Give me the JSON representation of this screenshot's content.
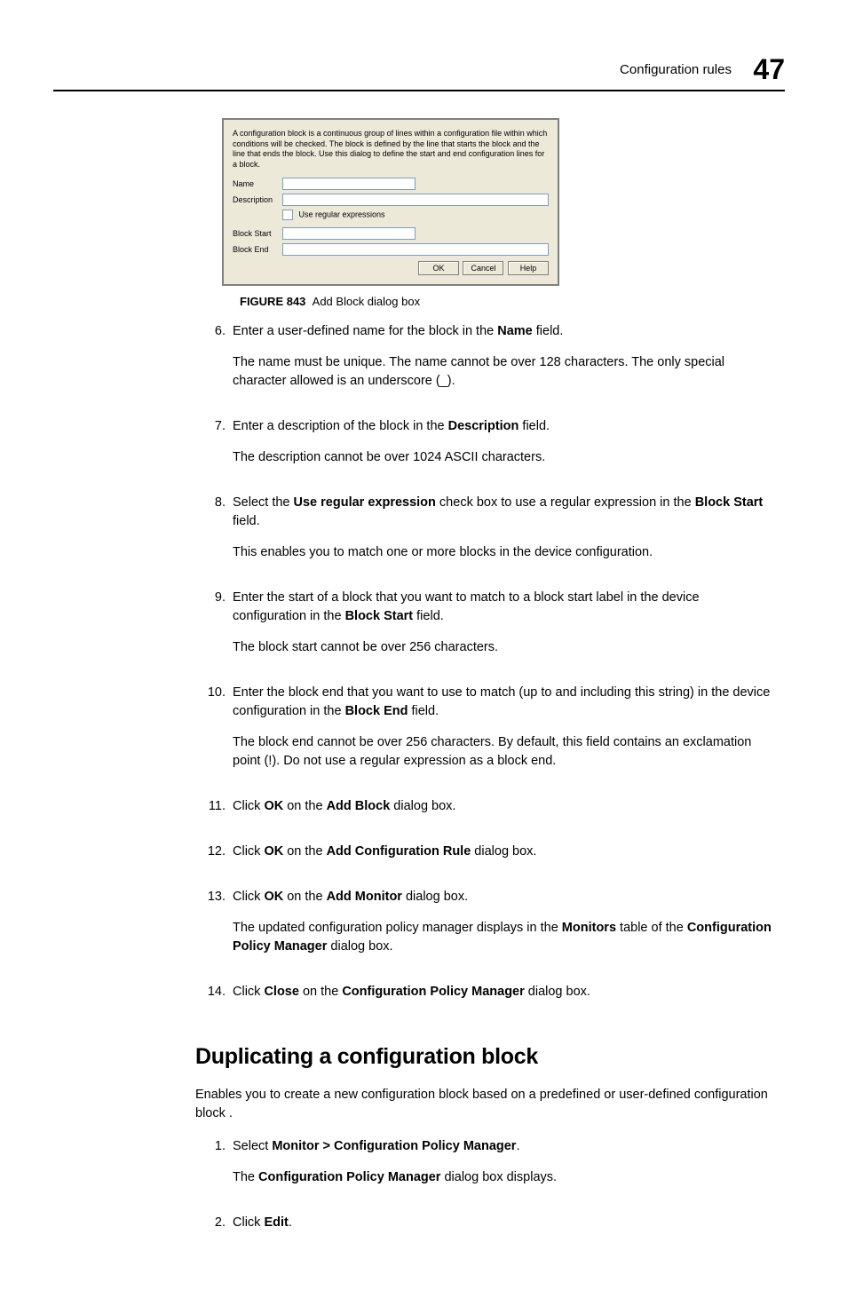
{
  "header": {
    "title": "Configuration rules",
    "pageNumber": "47"
  },
  "dialog": {
    "intro": "A configuration block is a continuous group of lines within a configuration file within which conditions will be checked. The block is defined by the line that starts the block and the line that ends the block. Use this dialog to define the start and end configuration lines for a block.",
    "labels": {
      "name": "Name",
      "description": "Description",
      "regex": "Use regular expressions",
      "blockStart": "Block Start",
      "blockEnd": "Block End"
    },
    "buttons": {
      "ok": "OK",
      "cancel": "Cancel",
      "help": "Help"
    }
  },
  "figure": {
    "label": "FIGURE 843",
    "caption": "Add Block dialog box"
  },
  "steps": {
    "s6": {
      "num": "6.",
      "t1a": "Enter a user-defined name for the block in the ",
      "b1": "Name",
      "t1b": " field.",
      "t2": "The name must be unique. The name cannot be over 128 characters. The only special character allowed is an underscore (_)."
    },
    "s7": {
      "num": "7.",
      "t1a": "Enter a description of the block in the ",
      "b1": "Description",
      "t1b": " field.",
      "t2": "The description cannot be over 1024 ASCII characters."
    },
    "s8": {
      "num": "8.",
      "t1a": "Select the ",
      "b1": "Use regular expression",
      "t1b": " check box to use a regular expression in the ",
      "b2": "Block Start",
      "t1c": " field.",
      "t2": "This enables you to match one or more blocks in the device configuration."
    },
    "s9": {
      "num": "9.",
      "t1a": "Enter the start of a block that you want to match to a block start label in the device configuration in the ",
      "b1": "Block Start",
      "t1b": " field.",
      "t2": "The block start cannot be over 256 characters."
    },
    "s10": {
      "num": "10.",
      "t1a": "Enter the block end that you want to use to match (up to and including this string) in the device configuration in the ",
      "b1": "Block End",
      "t1b": " field.",
      "t2": "The block end cannot be over 256 characters. By default, this field contains an exclamation point (!). Do not use a regular expression as a block end."
    },
    "s11": {
      "num": "11.",
      "t1a": "Click ",
      "b1": "OK",
      "t1b": " on the ",
      "b2": "Add Block",
      "t1c": " dialog box."
    },
    "s12": {
      "num": "12.",
      "t1a": "Click ",
      "b1": "OK",
      "t1b": " on the ",
      "b2": "Add Configuration Rule",
      "t1c": " dialog box."
    },
    "s13": {
      "num": "13.",
      "t1a": "Click ",
      "b1": "OK",
      "t1b": " on the ",
      "b2": "Add Monitor",
      "t1c": " dialog box.",
      "t2a": "The updated configuration policy manager displays in the ",
      "b3": "Monitors",
      "t2b": " table of the ",
      "b4": "Configuration Policy Manager",
      "t2c": " dialog box."
    },
    "s14": {
      "num": "14.",
      "t1a": "Click ",
      "b1": "Close",
      "t1b": " on the ",
      "b2": "Configuration Policy Manager",
      "t1c": " dialog box."
    }
  },
  "section2": {
    "heading": "Duplicating a configuration block",
    "intro": "Enables you to create a new configuration block based on a predefined or user-defined configuration block .",
    "s1": {
      "num": "1.",
      "t1a": "Select ",
      "b1": "Monitor > Configuration Policy Manager",
      "t1b": ".",
      "t2a": "The ",
      "b2": "Configuration Policy Manager",
      "t2b": " dialog box displays."
    },
    "s2": {
      "num": "2.",
      "t1a": "Click ",
      "b1": "Edit",
      "t1b": "."
    }
  }
}
